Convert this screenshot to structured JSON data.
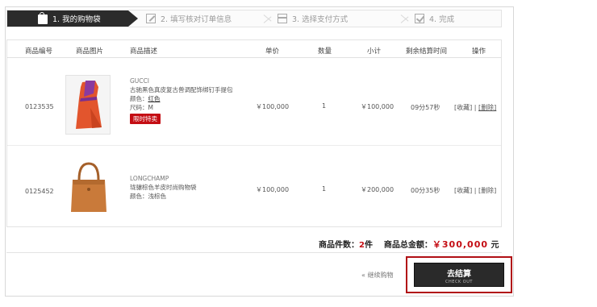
{
  "steps": [
    {
      "label": "1. 我的购物袋",
      "icon": "shopping-bag-icon"
    },
    {
      "label": "2. 填写核对订单信息",
      "icon": "edit-icon"
    },
    {
      "label": "3. 选择支付方式",
      "icon": "card-icon"
    },
    {
      "label": "4. 完成",
      "icon": "check-icon"
    }
  ],
  "table": {
    "headers": [
      "商品编号",
      "商品图片",
      "商品描述",
      "单价",
      "数量",
      "小计",
      "剩余结算时间",
      "操作"
    ],
    "rows": [
      {
        "id": "0123535",
        "brand": "GUCCI",
        "name": "古驰黑色真皮复古兽调配饰绑钉手提包",
        "color_label": "颜色：",
        "color_value": "红色",
        "size_label": "尺码：",
        "size_value": "M",
        "tag": "限时特卖",
        "price": "￥100,000",
        "qty": "1",
        "subtotal": "￥100,000",
        "time_left": "09分57秒",
        "op_fav": "[收藏]",
        "op_sep": "|",
        "op_del": "[删除]"
      },
      {
        "id": "0125452",
        "brand": "LONGCHAMP",
        "name": "珑骧棕色羊皮时尚购物袋",
        "color_label": "颜色：",
        "color_value": "浅棕色",
        "price": "￥100,000",
        "qty": "1",
        "subtotal": "￥200,000",
        "time_left": "00分35秒",
        "op_fav": "[收藏]",
        "op_sep": "|",
        "op_del": "[删除]"
      }
    ]
  },
  "summary": {
    "count_label": "商品件数：",
    "count_value": "2",
    "count_unit": "件",
    "total_label": "商品总金额：",
    "total_currency": "￥",
    "total_value": "300,000",
    "total_unit": "元"
  },
  "actions": {
    "continue_label": "继续购物",
    "checkout_label": "去结算",
    "checkout_sub": "CHECK OUT"
  },
  "colors": {
    "accent_red": "#c40d14",
    "step_active": "#2b2b2b"
  }
}
